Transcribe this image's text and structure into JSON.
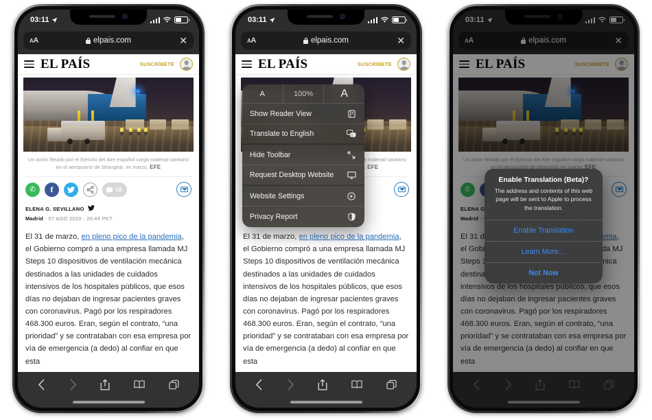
{
  "status_bar": {
    "time": "03:11",
    "location_icon": "location-arrow-icon",
    "signal_icon": "cellular-bars-icon",
    "wifi_icon": "wifi-icon",
    "battery_icon": "battery-icon"
  },
  "browser": {
    "text_size_button": "AA",
    "lock_icon": "lock-icon",
    "url": "elpais.com",
    "close_label": "✕",
    "toolbar": {
      "back": "back-icon",
      "forward": "forward-icon",
      "share": "share-icon",
      "bookmarks": "bookmarks-icon",
      "tabs": "tabs-icon"
    }
  },
  "site": {
    "menu_icon": "hamburger-icon",
    "brand": "EL PAÍS",
    "subscribe": "SUSCRÍBETE",
    "avatar": "account-avatar"
  },
  "article": {
    "image_alt": "Cargo plane being loaded at night on airport tarmac",
    "caption": "Un avión fletado por el Ejército del Aire español carga material sanitario en el aeropuerto de Shanghái, en marzo.",
    "caption_credit": "EFE",
    "share": {
      "whatsapp": "whatsapp-icon",
      "facebook": "f",
      "twitter": "twitter-icon",
      "share_more": "share-nodes-icon",
      "comment_count": "18",
      "email": "email-icon"
    },
    "author": "ELENA G. SEVILLANO",
    "author_twitter_icon": "twitter-bird-icon",
    "city": "Madrid",
    "date": "- 07 AGO 2020 - 20:44 PKT",
    "body_before_link": "El 31 de marzo, ",
    "body_link": "en pleno pico de la pandemia",
    "body_after_link": ", el Gobierno compró a una empresa llamada MJ Steps 10 dispositivos de ventilación mecánica destinados a las unidades de cuidados intensivos de los hospitales públicos, que esos días no dejaban de ingresar pacientes graves con coronavirus. Pagó por los respiradores 468.300 euros. Eran, según el contrato, “una prioridad” y se contrataban con esa empresa por vía de emergencia (a dedo) al confiar en que esta"
  },
  "aa_menu": {
    "zoom_small": "A",
    "zoom_level": "100%",
    "zoom_large": "A",
    "items": [
      {
        "label": "Show Reader View",
        "icon": "reader-view-icon"
      },
      {
        "label": "Translate to English",
        "icon": "translate-icon"
      },
      {
        "label": "Hide Toolbar",
        "icon": "hide-toolbar-icon"
      },
      {
        "label": "Request Desktop Website",
        "icon": "desktop-monitor-icon"
      },
      {
        "label": "Website Settings",
        "icon": "website-settings-icon"
      },
      {
        "label": "Privacy Report",
        "icon": "privacy-report-icon"
      }
    ]
  },
  "alert": {
    "title": "Enable Translation (Beta)?",
    "message": "The address and contents of this web page will be sent to Apple to process the translation.",
    "buttons": [
      {
        "label": "Enable Translation",
        "emphasis": "normal"
      },
      {
        "label": "Learn More…",
        "emphasis": "normal"
      },
      {
        "label": "Not Now",
        "emphasis": "bold"
      }
    ]
  },
  "colors": {
    "accent_blue": "#3b8cf5",
    "link_blue": "#2a6ebb",
    "brand_gold": "#c9a227",
    "toolbar_bg": "#323232"
  }
}
